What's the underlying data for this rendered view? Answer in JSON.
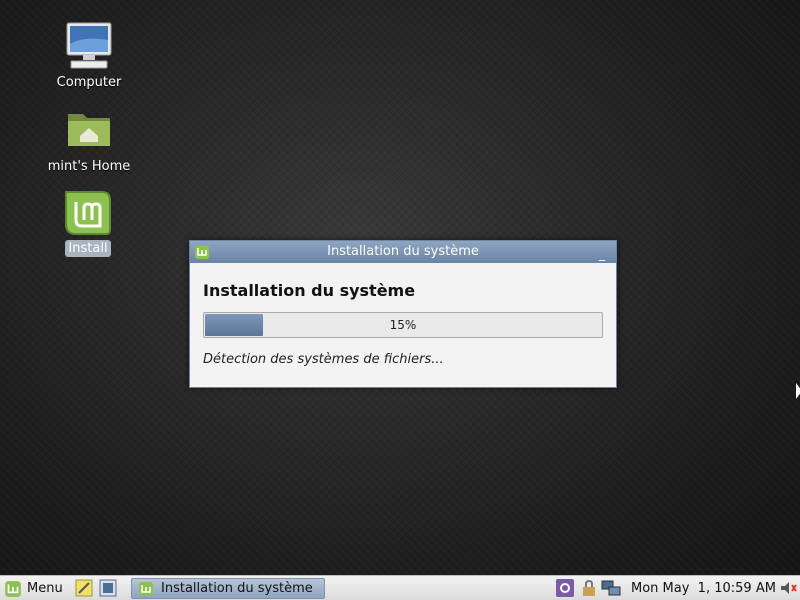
{
  "desktop": {
    "icons": [
      {
        "label": "Computer",
        "icon": "computer-icon"
      },
      {
        "label": "mint's Home",
        "icon": "home-folder-icon"
      },
      {
        "label": "Install",
        "icon": "mint-install-icon"
      }
    ]
  },
  "dialog": {
    "title": "Installation du système",
    "heading": "Installation du système",
    "progress_fraction": 0.15,
    "progress_label": "15%",
    "status": "Détection des systèmes de fichiers...",
    "minimize_glyph": "_"
  },
  "taskbar": {
    "menu_label": "Menu",
    "task_label": "Installation du système",
    "clock": "Mon May  1, 10:59 AM",
    "tray_icons": [
      "settings-icon",
      "lock-icon",
      "network-icon",
      "volume-icon"
    ]
  },
  "colors": {
    "accent": "#6a84a6",
    "mint_green": "#8cc152"
  }
}
